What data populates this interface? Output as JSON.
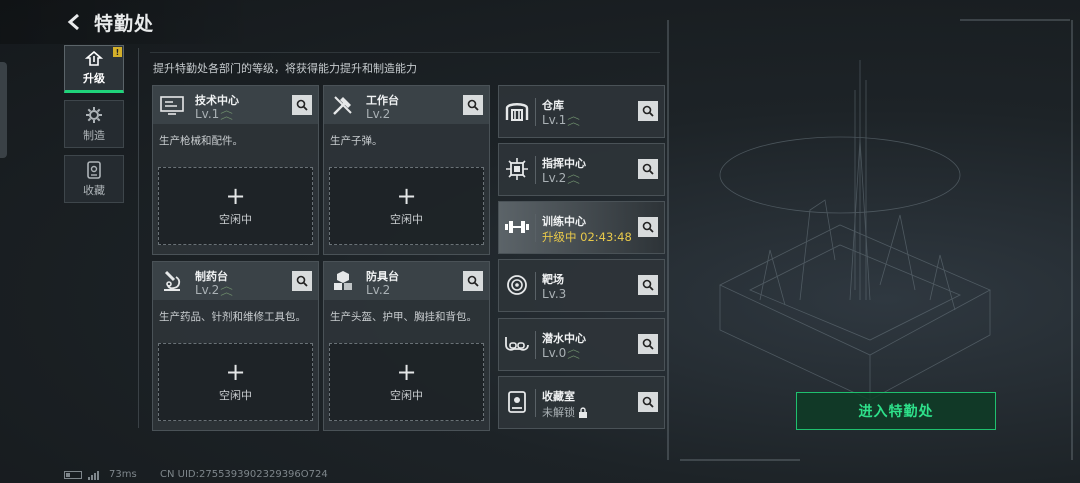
{
  "header": {
    "title": "特勤处",
    "back_icon": "back-arrow-icon"
  },
  "sidebar": {
    "tabs": [
      {
        "label": "升级",
        "icon": "upgrade-icon",
        "active": true,
        "badge": "!"
      },
      {
        "label": "制造",
        "icon": "gear-icon",
        "active": false
      },
      {
        "label": "收藏",
        "icon": "collection-icon",
        "active": false
      }
    ]
  },
  "description": "提升特勤处各部门的等级，将获得能力提升和制造能力",
  "workshops": [
    {
      "name": "技术中心",
      "level": "Lv.1",
      "desc": "生产枪械和配件。",
      "slot_label": "空闲中",
      "icon": "tech-center-icon"
    },
    {
      "name": "工作台",
      "level": "Lv.2",
      "desc": "生产子弹。",
      "slot_label": "空闲中",
      "icon": "workbench-icon"
    },
    {
      "name": "制药台",
      "level": "Lv.2",
      "desc": "生产药品、针剂和维修工具包。",
      "slot_label": "空闲中",
      "icon": "pharmacy-icon"
    },
    {
      "name": "防具台",
      "level": "Lv.2",
      "desc": "生产头盔、护甲、胸挂和背包。",
      "slot_label": "空闲中",
      "icon": "armor-bench-icon"
    }
  ],
  "facilities": [
    {
      "name": "仓库",
      "status": "Lv.1",
      "icon": "warehouse-icon"
    },
    {
      "name": "指挥中心",
      "status": "Lv.2",
      "icon": "command-center-icon"
    },
    {
      "name": "训练中心",
      "status": "升级中 02:43:48",
      "icon": "dumbbell-icon"
    },
    {
      "name": "靶场",
      "status": "Lv.3",
      "icon": "target-icon"
    },
    {
      "name": "潜水中心",
      "status": "Lv.0",
      "icon": "diving-mask-icon"
    },
    {
      "name": "收藏室",
      "status": "未解锁",
      "icon": "collection-room-icon"
    }
  ],
  "enter_button": "进入特勤处",
  "footer": {
    "ping": "73ms",
    "uid": "CN UID:2755393902329396O724"
  },
  "colors": {
    "accent": "#1fd37a",
    "upgrading": "#e8c94a",
    "panel": "#2e3438"
  }
}
